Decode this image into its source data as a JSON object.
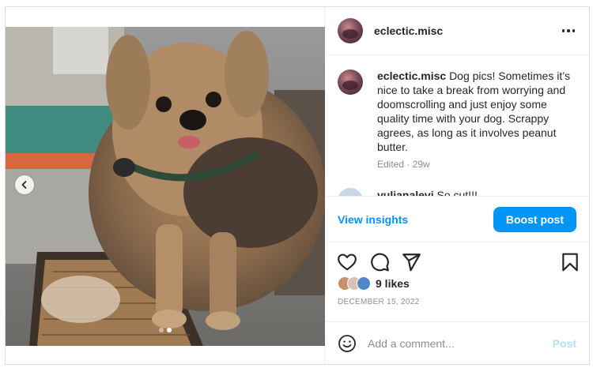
{
  "post": {
    "username": "eclectic.misc",
    "caption_username": "eclectic.misc",
    "caption": "Dog pics! Sometimes it’s nice to take a break from worrying and doomscrolling and just enjoy some quality time with your dog. Scrappy agrees, as long as it involves peanut butter.",
    "caption_meta": "Edited · 29w",
    "likes": "9 likes",
    "date": "DECEMBER 15, 2022"
  },
  "comments": [
    {
      "username": "yulianalevi",
      "text": "So cut!!!"
    }
  ],
  "insights": {
    "view_label": "View insights",
    "boost_label": "Boost post"
  },
  "compose": {
    "placeholder": "Add a comment...",
    "post_label": "Post"
  },
  "carousel": {
    "slides": 2,
    "active_index": 1
  },
  "icons": {
    "more": "more-options-icon",
    "like": "heart-icon",
    "comment": "comment-icon",
    "share": "share-icon",
    "save": "bookmark-icon",
    "emoji": "emoji-icon",
    "prev": "chevron-left-icon"
  },
  "colors": {
    "accent": "#0095f6",
    "post_disabled": "#b2dffc",
    "meta": "#8e8e8e"
  }
}
